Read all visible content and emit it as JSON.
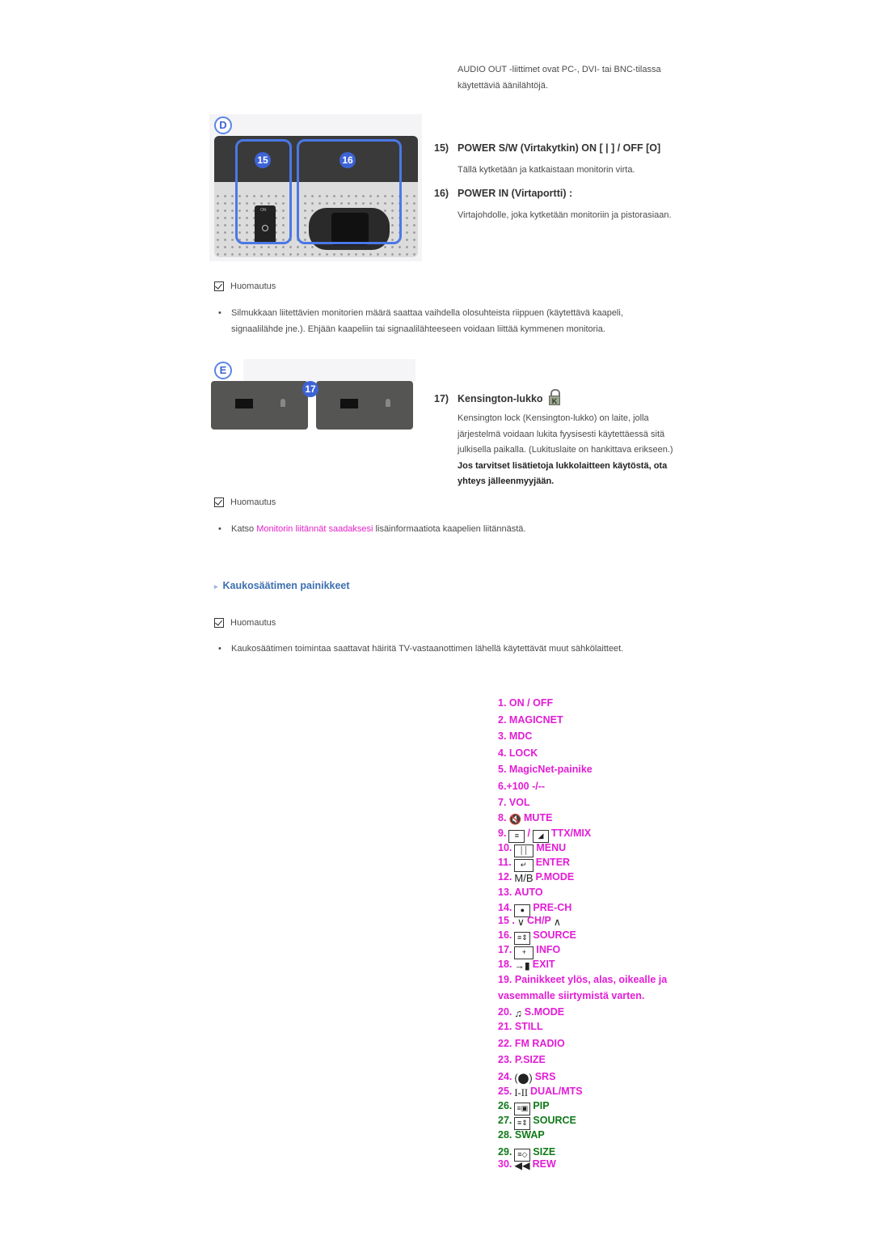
{
  "intro_text": [
    "AUDIO OUT -liittimet ovat PC-, DVI- tai BNC-tilassa",
    "käytettäviä äänilähtöjä."
  ],
  "section_d": {
    "letter": "D",
    "badges": [
      "15",
      "16"
    ],
    "items": [
      {
        "num": "15)",
        "title": "POWER S/W (Virtakytkin) ON [ | ] / OFF [O]",
        "desc": "Tällä kytketään ja katkaistaan monitorin virta."
      },
      {
        "num": "16)",
        "title": "POWER IN (Virtaportti) :",
        "desc": "Virtajohdolle, joka kytketään monitoriin ja pistorasiaan."
      }
    ],
    "note_label": "Huomautus",
    "bullet": [
      "Silmukkaan liitettävien monitorien määrä saattaa vaihdella olosuhteista riippuen (käytettävä kaapeli,",
      "signaalilähde jne.). Ehjään kaapeliin tai signaalilähteeseen voidaan liittää kymmenen monitoria."
    ]
  },
  "section_e": {
    "letter": "E",
    "badge": "17",
    "item": {
      "num": "17)",
      "title": "Kensington-lukko",
      "lock_icon_letter": "K",
      "desc_lines": [
        "Kensington lock (Kensington-lukko) on laite, jolla",
        "järjestelmä voidaan lukita fyysisesti käytettäessä sitä",
        "julkisella paikalla. (Lukituslaite on hankittava erikseen.)"
      ],
      "bold_lines": [
        "Jos tarvitset lisätietoja lukkolaitteen käytöstä, ota",
        "yhteys jälleenmyyjään."
      ]
    },
    "note_label": "Huomautus",
    "bullet_prefix": "Katso ",
    "bullet_link": "Monitorin liitännät saadaksesi",
    "bullet_suffix": " lisäinformaatiota kaapelien liitännästä."
  },
  "remote_section": {
    "heading": "Kaukosäätimen painikkeet",
    "note_label": "Huomautus",
    "bullet": "Kaukosäätimen toimintaa saattavat häiritä TV-vastaanottimen lähellä käytettävät muut sähkölaitteet.",
    "buttons": [
      {
        "num": "1.",
        "label": "ON / OFF",
        "icon": null,
        "color": "pink"
      },
      {
        "num": "2.",
        "label": "MAGICNET",
        "icon": null,
        "color": "pink"
      },
      {
        "num": "3.",
        "label": "MDC",
        "icon": null,
        "color": "pink"
      },
      {
        "num": "4.",
        "label": "LOCK",
        "icon": null,
        "color": "pink"
      },
      {
        "num": "5.",
        "label": "MagicNet-painike",
        "icon": null,
        "color": "pink"
      },
      {
        "num": "6.",
        "label": "+100 -/--",
        "icon": null,
        "color": "pink"
      },
      {
        "num": "7.",
        "label": "VOL",
        "icon": null,
        "color": "pink"
      },
      {
        "num": "8.",
        "label": "MUTE",
        "icon": "mute-icon",
        "color": "pink"
      },
      {
        "num": "9.",
        "label": "TTX/MIX",
        "icon": "teletext-icon",
        "color": "pink"
      },
      {
        "num": "10.",
        "label": "MENU",
        "icon": "menu-icon",
        "color": "pink"
      },
      {
        "num": "11.",
        "label": "ENTER",
        "icon": "enter-icon",
        "color": "pink"
      },
      {
        "num": "12.",
        "label": "P.MODE",
        "icon_text": "M/B",
        "icon": "mb-icon",
        "color": "pink"
      },
      {
        "num": "13.",
        "label": "AUTO",
        "icon": null,
        "color": "pink"
      },
      {
        "num": "14.",
        "label": "PRE-CH",
        "icon": "pre-ch-icon",
        "color": "pink"
      },
      {
        "num": "15 .",
        "label": "CH/P",
        "icon": "chevron-down-icon",
        "icon_after": "chevron-up-icon",
        "color": "pink"
      },
      {
        "num": "16.",
        "label": "SOURCE",
        "icon": "source-icon",
        "color": "pink"
      },
      {
        "num": "17.",
        "label": "INFO",
        "icon": "info-icon",
        "color": "pink"
      },
      {
        "num": "18.",
        "label": "EXIT",
        "icon": "exit-icon",
        "color": "pink"
      },
      {
        "num": "19.",
        "label": "Painikkeet ylös, alas, oikealle ja vasemmalle siirtymistä varten.",
        "icon": null,
        "color": "pink"
      },
      {
        "num": "20.",
        "label": "S.MODE",
        "icon": "sound-mode-icon",
        "color": "pink"
      },
      {
        "num": "21.",
        "label": "STILL",
        "icon": null,
        "color": "pink"
      },
      {
        "num": "22.",
        "label": "FM RADIO",
        "icon": null,
        "color": "pink"
      },
      {
        "num": "23.",
        "label": "P.SIZE",
        "icon": null,
        "color": "pink"
      },
      {
        "num": "24.",
        "label": "SRS",
        "icon": "srs-icon",
        "color": "pink"
      },
      {
        "num": "25.",
        "label": "DUAL/MTS",
        "icon": "dual-icon",
        "color": "pink"
      },
      {
        "num": "26.",
        "label": "PIP",
        "icon": "pip-icon",
        "color": "green"
      },
      {
        "num": "27.",
        "label": "SOURCE",
        "icon": "source-icon",
        "color": "green"
      },
      {
        "num": "28.",
        "label": "SWAP",
        "icon": null,
        "color": "green"
      },
      {
        "num": "29.",
        "label": "SIZE",
        "icon": "size-icon",
        "color": "green"
      },
      {
        "num": "30.",
        "label": "REW",
        "icon": "rewind-icon",
        "color": "pink"
      }
    ]
  },
  "colors": {
    "pink": "#e31cd6",
    "green": "#0f7a18",
    "heading_blue": "#3d6fb0",
    "badge_blue": "#3d63d6",
    "link": "#e620c8"
  }
}
